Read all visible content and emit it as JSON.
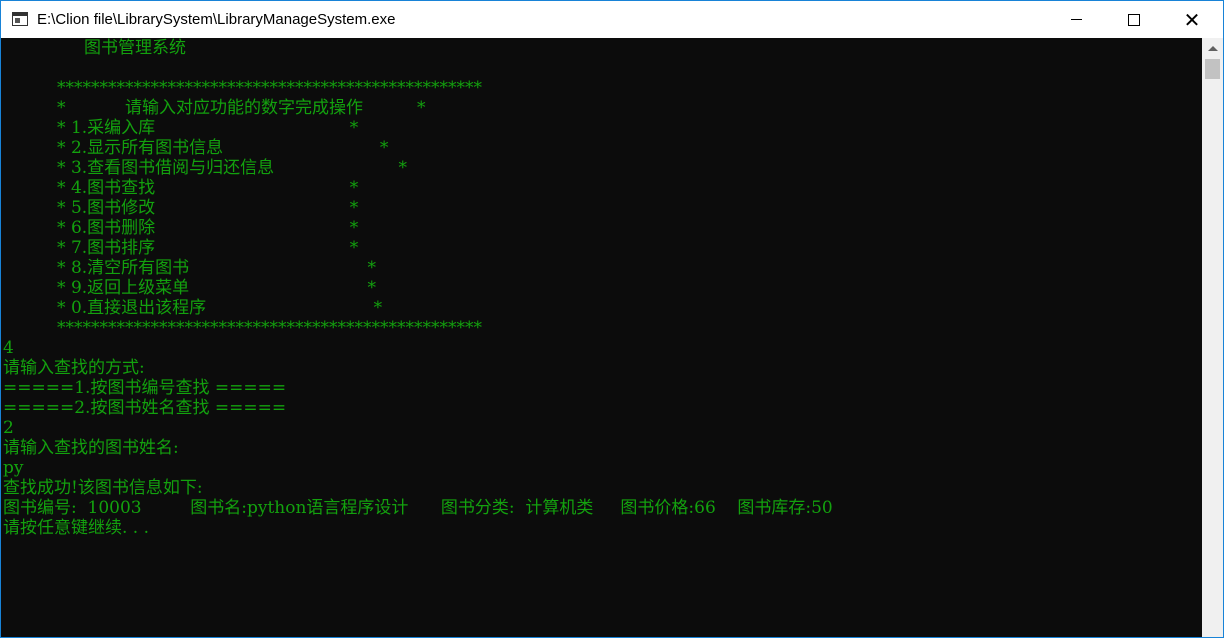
{
  "window": {
    "title": "E:\\Clion file\\LibrarySystem\\LibraryManageSystem.exe",
    "controls": {
      "minimize": "",
      "maximize": "",
      "close": "✕"
    }
  },
  "console": {
    "text_color": "#13a10e",
    "background": "#0c0c0c",
    "lines": [
      "               图书管理系统",
      "",
      "          **************************************************",
      "          *           请输入对应功能的数字完成操作          *",
      "          * 1.采编入库                                    *",
      "          * 2.显示所有图书信息                             *",
      "          * 3.查看图书借阅与归还信息                       *",
      "          * 4.图书查找                                    *",
      "          * 5.图书修改                                    *",
      "          * 6.图书删除                                    *",
      "          * 7.图书排序                                    *",
      "          * 8.清空所有图书                                 *",
      "          * 9.返回上级菜单                                 *",
      "          * 0.直接退出该程序                               *",
      "          **************************************************",
      "4",
      "请输入查找的方式:",
      "=====1.按图书编号查找 =====",
      "=====2.按图书姓名查找 =====",
      "2",
      "请输入查找的图书姓名:",
      "py",
      "查找成功!该图书信息如下:",
      "图书编号:  10003         图书名:python语言程序设计      图书分类:  计算机类     图书价格:66    图书库存:50",
      "请按任意键继续. . ."
    ]
  }
}
